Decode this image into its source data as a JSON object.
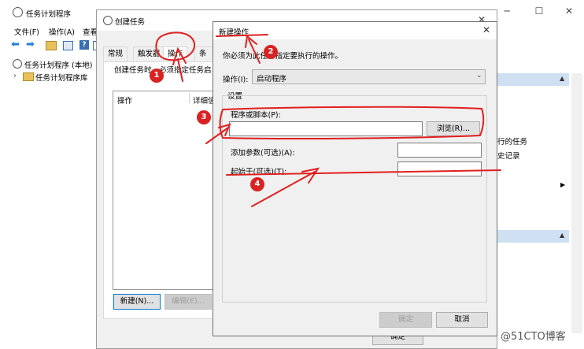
{
  "main_window": {
    "title": "任务计划程序",
    "menu": [
      "文件(F)",
      "操作(A)",
      "查看"
    ],
    "tree": [
      "任务计划程序 (本地)",
      "任务计划程序库"
    ],
    "right_panel": {
      "item1": "行的任务",
      "item2": "史记录"
    }
  },
  "create_task": {
    "title": "创建任务",
    "tabs": [
      "常规",
      "触发器",
      "操作",
      "条件"
    ],
    "description": "创建任务时，必须指定任务启",
    "table_headers": [
      "操作",
      "详细信"
    ],
    "new_button": "新建(N)...",
    "edit_button": "编辑(E)...",
    "ok_button": "确定"
  },
  "new_action": {
    "title": "新建操作",
    "instruction": "你必须为此任务指定要执行的操作。",
    "action_label": "操作(I):",
    "action_value": "启动程序",
    "settings_label": "设置",
    "program_label": "程序或脚本(P):",
    "program_value": "",
    "browse_button": "浏览(R)...",
    "args_label": "添加参数(可选)(A):",
    "args_value": "",
    "start_label": "起始于(可选)(T):",
    "start_value": "",
    "ok_button": "确定",
    "cancel_button": "取消"
  },
  "annotations": [
    "1",
    "2",
    "3",
    "4"
  ],
  "watermark": "@51CTO博客",
  "colors": {
    "annotation": "#e02020",
    "accent": "#0078d7",
    "panel_header": "#cfe0f3"
  }
}
